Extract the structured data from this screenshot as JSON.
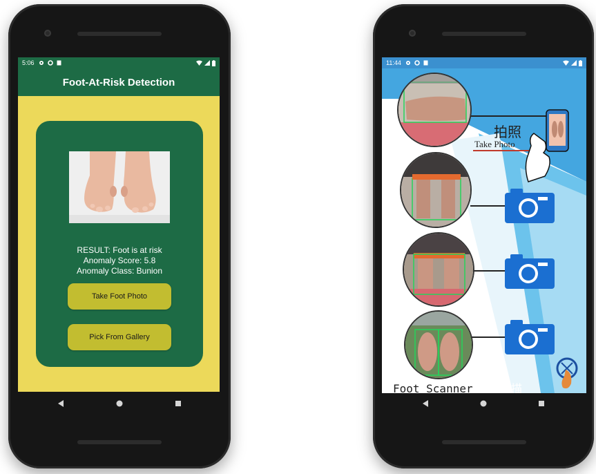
{
  "left_phone": {
    "status": {
      "time": "5:06"
    },
    "title": "Foot-At-Risk Detection",
    "result": {
      "line1": "RESULT: Foot is at risk",
      "line2": "Anomaly Score: 5.8",
      "line3": "Anomaly Class: Bunion"
    },
    "buttons": {
      "take_photo": "Take Foot Photo",
      "gallery": "Pick From Gallery"
    }
  },
  "right_phone": {
    "status": {
      "time": "11:44"
    },
    "take_photo_cn": "拍照",
    "take_photo_en": "Take Photo",
    "footer_en": "Foot Scanner",
    "footer_cn": "足部扫描"
  },
  "colors": {
    "app_green": "#1d6b45",
    "yellow_bg": "#ecd95a",
    "button_yellow": "#c2bd30",
    "camera_blue": "#1b6fd1",
    "sky_blue": "#44a6e0"
  },
  "icons": [
    "settings-icon",
    "circle-icon",
    "sim-icon",
    "wifi-icon",
    "signal-icon",
    "battery-icon",
    "back-icon",
    "home-icon",
    "recents-icon",
    "camera-icon",
    "hand-phone-icon",
    "foot-logo-icon"
  ]
}
